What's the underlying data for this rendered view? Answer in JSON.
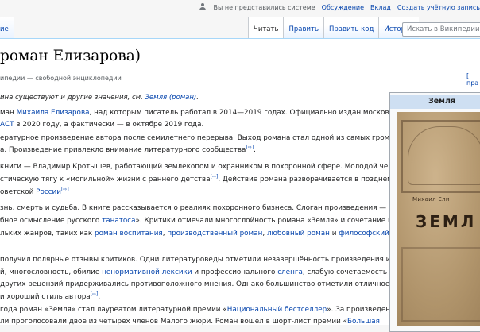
{
  "personal": {
    "status": "Вы не представились системе",
    "links": [
      "Обсуждение",
      "Вклад",
      "Создать учётную запись"
    ]
  },
  "left_tab": "ие",
  "tabs": [
    "Читать",
    "Править",
    "Править код",
    "История"
  ],
  "search": {
    "placeholder": "Искать в Википедии"
  },
  "page": {
    "title": "роман Елизарова)",
    "tagline": "ипедии — свободной энциклопедии",
    "edit": "[ пра"
  },
  "hatnote": {
    "text": "ина существуют и другие значения, см. ",
    "link": "Земля (роман)",
    "end": "."
  },
  "paragraphs": [
    [
      {
        "t": "ман "
      },
      {
        "l": "Михаила Елизарова"
      },
      {
        "t": ", над которым писатель работал в 2014—2019 годах. Официально издан московским"
      }
    ],
    [
      {
        "l": "АСТ"
      },
      {
        "t": " в 2020 году, а фактически — в октябре 2019 года."
      }
    ],
    [
      {
        "t": "ературное произведение автора после семилетнего перерыва. Выход романа стал одной из самых громких"
      }
    ],
    [
      {
        "t": "а. Произведение привлекло внимание литературного сообщества"
      },
      {
        "r": "[⇨]"
      },
      {
        "t": "."
      }
    ],
    [
      {
        "t": "книги — Владимир Кротышев, работающий землекопом и охранником в похоронной сфере. Молодой человек"
      }
    ],
    [
      {
        "t": "стическую тягу к «могильной» жизни с раннего детства"
      },
      {
        "r": "[⇨]"
      },
      {
        "t": ". Действие романа разворачивается в позднем"
      }
    ],
    [
      {
        "t": "оветской "
      },
      {
        "l": "России"
      },
      {
        "r": "[⇨]"
      }
    ],
    [
      {
        "t": "знь, смерть и судьба. В книге рассказывается о реалиях похоронного бизнеса. Слоган произведения —"
      }
    ],
    [
      {
        "t": "бное осмысление русского "
      },
      {
        "l": "танатоса"
      },
      {
        "t": "». Критики отмечали многослойность романа «Земля» и сочетание в"
      }
    ],
    [
      {
        "t": "льких жанров, таких как "
      },
      {
        "l": "роман воспитания"
      },
      {
        "t": ", "
      },
      {
        "l": "производственный роман"
      },
      {
        "t": ", "
      },
      {
        "l": "любовный роман"
      },
      {
        "t": " и "
      },
      {
        "l": "философский"
      }
    ],
    [
      {
        "t": " "
      }
    ],
    [
      {
        "t": "получил полярные отзывы критиков. Одни литературоведы отметили незавершённость произведения и"
      }
    ],
    [
      {
        "t": "й, многословность, обилие "
      },
      {
        "l": "ненормативной лексики"
      },
      {
        "t": " и профессионального "
      },
      {
        "l": "сленга"
      },
      {
        "t": ", слабую сочетаемость слоёв"
      }
    ],
    [
      {
        "t": " других рецензий придерживались противоположного мнения. Однако большинство отметили отличное"
      }
    ],
    [
      {
        "t": "и хороший стиль автора"
      },
      {
        "r": "[⇨]"
      },
      {
        "t": "."
      }
    ],
    [
      {
        "t": "года роман «Земля» стал лауреатом литературной премии «"
      },
      {
        "l": "Национальный бестселлер"
      },
      {
        "t": "». За произведение"
      }
    ],
    [
      {
        "t": "ли проголосовали двое из четырёх членов Малого жюри. Роман вошёл в шорт-лист премии «"
      },
      {
        "l": "Большая"
      }
    ]
  ],
  "infobox": {
    "title": "Земля",
    "cover_author": "Михаил Ели",
    "cover_title": "ЗЕМЛ"
  }
}
